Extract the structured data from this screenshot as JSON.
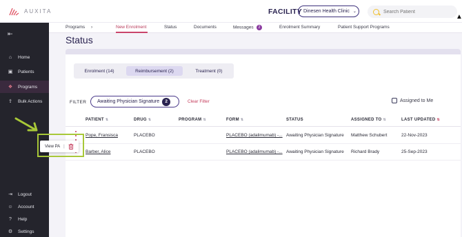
{
  "header": {
    "brand": "AUXITA",
    "facility_label": "FACILITY",
    "clinic": "Dinesen Health Clinic",
    "search_placeholder": "Search Patient"
  },
  "sidebar": {
    "items": [
      {
        "label": "Home",
        "icon": "home-icon"
      },
      {
        "label": "Patients",
        "icon": "patients-icon"
      },
      {
        "label": "Programs",
        "icon": "programs-icon",
        "active": true
      },
      {
        "label": "Bulk Actions",
        "icon": "bulk-actions-icon"
      },
      {
        "label": "Logout",
        "icon": "logout-icon"
      },
      {
        "label": "Account",
        "icon": "account-icon"
      },
      {
        "label": "Help",
        "icon": "help-icon"
      },
      {
        "label": "Settings",
        "icon": "settings-icon"
      }
    ]
  },
  "tabs": {
    "programs": "Programs",
    "new_enrolment": "New Enrolment",
    "status": "Status",
    "documents": "Documents",
    "messages": "Messages",
    "messages_badge": "2",
    "enrolment_summary": "Enrolment Summary",
    "patient_support": "Patient Support Programs"
  },
  "page": {
    "title": "Status"
  },
  "segments": [
    {
      "label": "Enrolment (14)"
    },
    {
      "label": "Reimbursement (2)",
      "active": true
    },
    {
      "label": "Treatment (0)"
    }
  ],
  "filter": {
    "label": "FILTER",
    "chip": "Awaiting Physician Signature",
    "chip_count": "2",
    "clear": "Clear Filter",
    "assigned_to_me": "Assigned to Me"
  },
  "table": {
    "columns": [
      "PATIENT",
      "DRUG",
      "PROGRAM",
      "FORM",
      "STATUS",
      "ASSIGNED TO",
      "LAST UPDATED"
    ],
    "rows": [
      {
        "patient": "Pope, Fransisca",
        "drug": "PLACEBO",
        "program": "",
        "form": "PLACEBO (adalimumab) -...",
        "status": "Awaiting Physician Signature",
        "assigned": "Matthew Schubert",
        "updated": "22-Nov-2023"
      },
      {
        "patient": "Barber, Alice",
        "drug": "PLACEBO",
        "program": "",
        "form": "PLACEBO (adalimumab) -...",
        "status": "Awaiting Physician Signature",
        "assigned": "Richard Brady",
        "updated": "25-Sep-2023"
      }
    ]
  },
  "popup": {
    "view_pa": "View PA",
    "separator": "|"
  },
  "colors": {
    "accent": "#c9436a",
    "primary": "#2a2350",
    "sidebar": "#24242c",
    "highlight": "#a8c838"
  }
}
